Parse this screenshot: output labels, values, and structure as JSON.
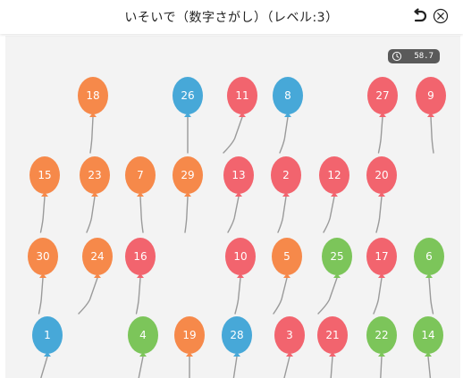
{
  "header": {
    "title": "いそいで（数字さがし）（レベル:3）",
    "back_icon": "back-arrow-icon",
    "close_icon": "close-circle-icon"
  },
  "timer": {
    "icon": "clock-icon",
    "value": "58.7"
  },
  "colors": {
    "orange": "#f6894a",
    "blue": "#47a8d8",
    "red": "#f2646e",
    "green": "#7cc55a",
    "string": "#9a9a9a",
    "background": "#f3f3f3"
  },
  "balloons": [
    {
      "number": "18",
      "color": "orange"
    },
    {
      "number": "26",
      "color": "blue"
    },
    {
      "number": "11",
      "color": "red"
    },
    {
      "number": "8",
      "color": "blue"
    },
    {
      "number": "27",
      "color": "red"
    },
    {
      "number": "9",
      "color": "red"
    },
    {
      "number": "15",
      "color": "orange"
    },
    {
      "number": "23",
      "color": "orange"
    },
    {
      "number": "7",
      "color": "orange"
    },
    {
      "number": "29",
      "color": "orange"
    },
    {
      "number": "13",
      "color": "red"
    },
    {
      "number": "2",
      "color": "red"
    },
    {
      "number": "12",
      "color": "red"
    },
    {
      "number": "20",
      "color": "red"
    },
    {
      "number": "30",
      "color": "orange"
    },
    {
      "number": "24",
      "color": "orange"
    },
    {
      "number": "16",
      "color": "red"
    },
    {
      "number": "10",
      "color": "red"
    },
    {
      "number": "5",
      "color": "orange"
    },
    {
      "number": "25",
      "color": "green"
    },
    {
      "number": "17",
      "color": "red"
    },
    {
      "number": "6",
      "color": "green"
    },
    {
      "number": "1",
      "color": "blue"
    },
    {
      "number": "4",
      "color": "green"
    },
    {
      "number": "19",
      "color": "orange"
    },
    {
      "number": "28",
      "color": "blue"
    },
    {
      "number": "3",
      "color": "red"
    },
    {
      "number": "21",
      "color": "red"
    },
    {
      "number": "22",
      "color": "green"
    },
    {
      "number": "14",
      "color": "green"
    }
  ]
}
